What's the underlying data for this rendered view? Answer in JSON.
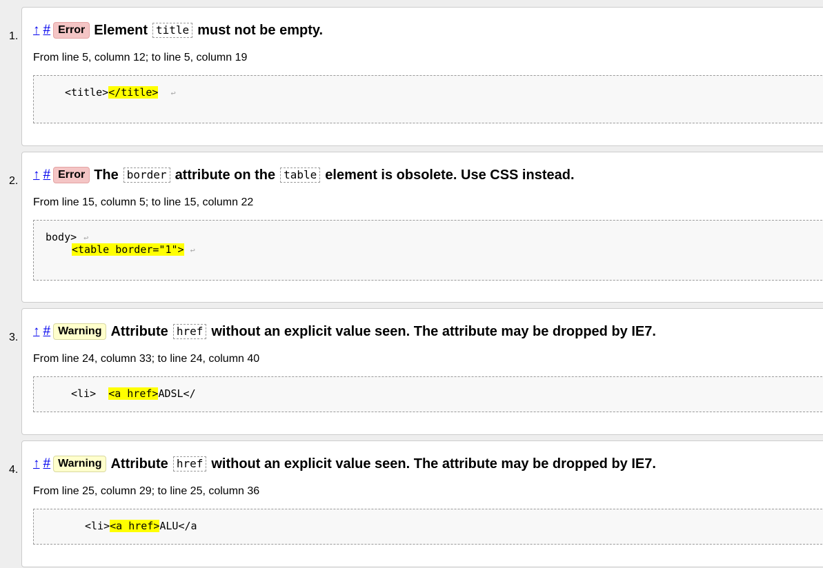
{
  "messages": [
    {
      "number": "1.",
      "up": "↑",
      "hash": "#",
      "type": "Error",
      "parts": [
        "Element",
        "title",
        "must not be empty."
      ],
      "location": "From line 5, column 12; to line 5, column 19",
      "extract": [
        {
          "pre": "<title>",
          "hl": "</title>",
          "post": "",
          "lf": "↩"
        }
      ]
    },
    {
      "number": "2.",
      "up": "↑",
      "hash": "#",
      "type": "Error",
      "parts": [
        "The",
        "border",
        "attribute on the",
        "table",
        "element is obsolete. Use CSS instead."
      ],
      "location": "From line 15, column 5; to line 15, column 22",
      "extract": [
        {
          "pre": "body>",
          "hl": "",
          "post": "",
          "lf": "↩"
        },
        {
          "pre": "",
          "hl": "<table border=\"1\">",
          "post": "",
          "lf": "↩"
        }
      ]
    },
    {
      "number": "3.",
      "up": "↑",
      "hash": "#",
      "type": "Warning",
      "parts": [
        "Attribute",
        "href",
        "without an explicit value seen. The attribute may be dropped by IE7."
      ],
      "location": "From line 24, column 33; to line 24, column 40",
      "extract": [
        {
          "pre": "<li>  ",
          "hl": "<a href>",
          "post": "ADSL</",
          "lf": ""
        }
      ]
    },
    {
      "number": "4.",
      "up": "↑",
      "hash": "#",
      "type": "Warning",
      "parts": [
        "Attribute",
        "href",
        "without an explicit value seen. The attribute may be dropped by IE7."
      ],
      "location": "From line 25, column 29; to line 25, column 36",
      "extract": [
        {
          "pre": "<li>",
          "hl": "<a href>",
          "post": "ALU</a",
          "lf": ""
        }
      ]
    }
  ]
}
